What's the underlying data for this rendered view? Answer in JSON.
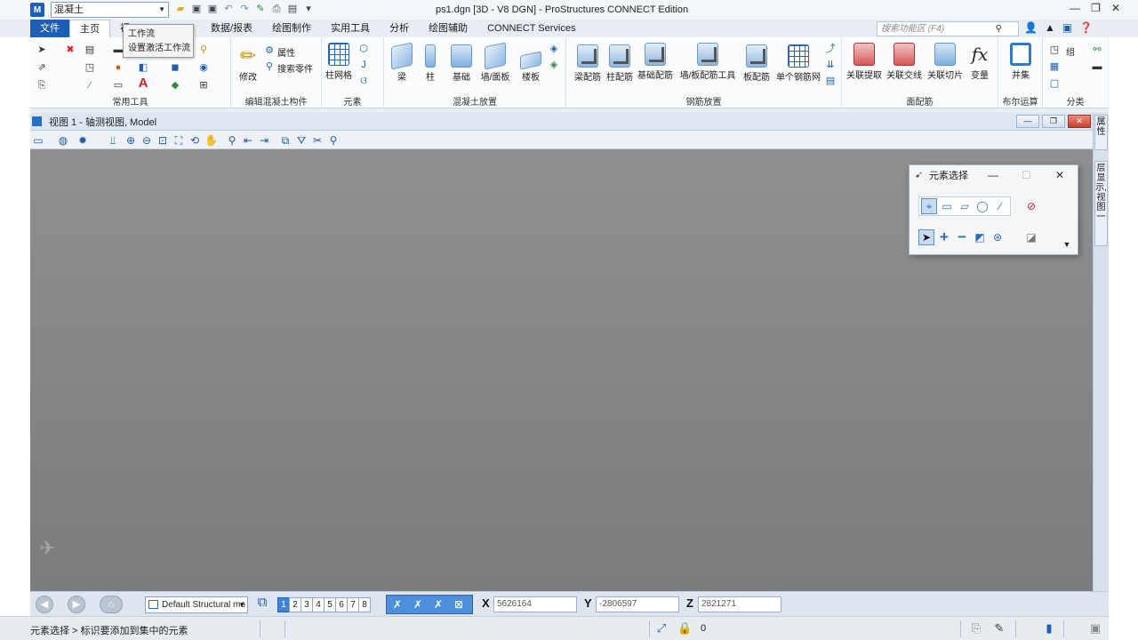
{
  "titlebar": {
    "workflow_value": "混凝土",
    "title": "ps1.dgn [3D - V8 DGN] - ProStructures CONNECT Edition"
  },
  "tabs": [
    {
      "label": "文件"
    },
    {
      "label": "主页"
    },
    {
      "label": "视"
    },
    {
      "label": "数据/报表"
    },
    {
      "label": "绘图制作"
    },
    {
      "label": "实用工具"
    },
    {
      "label": "分析"
    },
    {
      "label": "绘图辅助"
    },
    {
      "label": "CONNECT Services"
    }
  ],
  "search": {
    "placeholder": "搜索功能区 (F4)"
  },
  "tooltip": {
    "title": "工作流",
    "description": "设置激活工作流"
  },
  "ribbon": {
    "groups": {
      "common_tools": "常用工具",
      "edit_concrete": "编辑混凝土构件",
      "elements": "元素",
      "concrete_place": "混凝土放置",
      "rebar_place": "钢筋放置",
      "face_rebar": "面配筋",
      "boolean": "布尔运算",
      "classify": "分类"
    },
    "buttons": {
      "modify": "修改",
      "properties": "属性",
      "search_parts": "搜索零件",
      "column_grid": "柱网格",
      "beam": "梁",
      "column": "柱",
      "foundation": "基础",
      "wall_panel": "墙/面板",
      "slab": "楼板",
      "beam_rebar": "梁配筋",
      "column_rebar": "柱配筋",
      "foundation_rebar": "基础配筋",
      "wall_rebar_tools": "墙/板配筋工具",
      "slab_rebar": "板配筋",
      "single_mesh": "单个钢筋网",
      "assoc_extract": "关联提取",
      "assoc_intersect": "关联交线",
      "assoc_slice": "关联切片",
      "variable": "变量",
      "union": "并集",
      "group": "组"
    }
  },
  "view": {
    "title": "视图 1 - 轴测视图, Model"
  },
  "side_panel": {
    "tab1": "属性",
    "tab2": "层显示, 视图一"
  },
  "dialog": {
    "title": "元素选择"
  },
  "bottombar": {
    "model": "Default Structural mo",
    "view_numbers": [
      "1",
      "2",
      "3",
      "4",
      "5",
      "6",
      "7",
      "8"
    ],
    "x_label": "X",
    "x_value": "5626164",
    "y_label": "Y",
    "y_value": "-2806597",
    "z_label": "Z",
    "z_value": "2821271"
  },
  "status": {
    "prompt": "元素选择 > 标识要添加到集中的元素",
    "count": "0"
  },
  "colors": {
    "accent": "#1d5fb4",
    "viewport": "#858688",
    "active_snap": "#4c8fdd"
  }
}
